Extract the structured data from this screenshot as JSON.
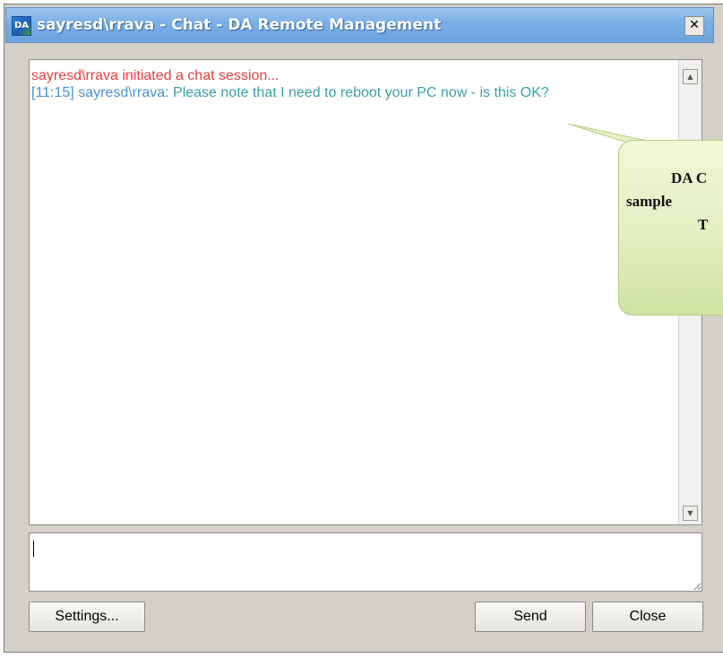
{
  "window": {
    "title": "sayresd\\rrava - Chat - DA Remote Management",
    "icon_label": "DA",
    "close_glyph": "✕"
  },
  "chat_log": {
    "system_line": "sayresd\\rrava initiated a chat session...",
    "message": {
      "timestamp": "[11:15]",
      "sender": "sayresd\\rrava:",
      "text": "Please note that I need to reboot your PC now - is this OK?"
    }
  },
  "callout": {
    "line1": "DA  C",
    "line2": "sample",
    "line3": "T"
  },
  "compose": {
    "value": "",
    "placeholder": ""
  },
  "buttons": {
    "settings": "Settings...",
    "send": "Send",
    "close": "Close"
  },
  "colors": {
    "system_text": "#e83d3d",
    "sender_text": "#4a93d0",
    "message_text": "#3aa0a6",
    "callout_fill": "#e2eec0"
  }
}
